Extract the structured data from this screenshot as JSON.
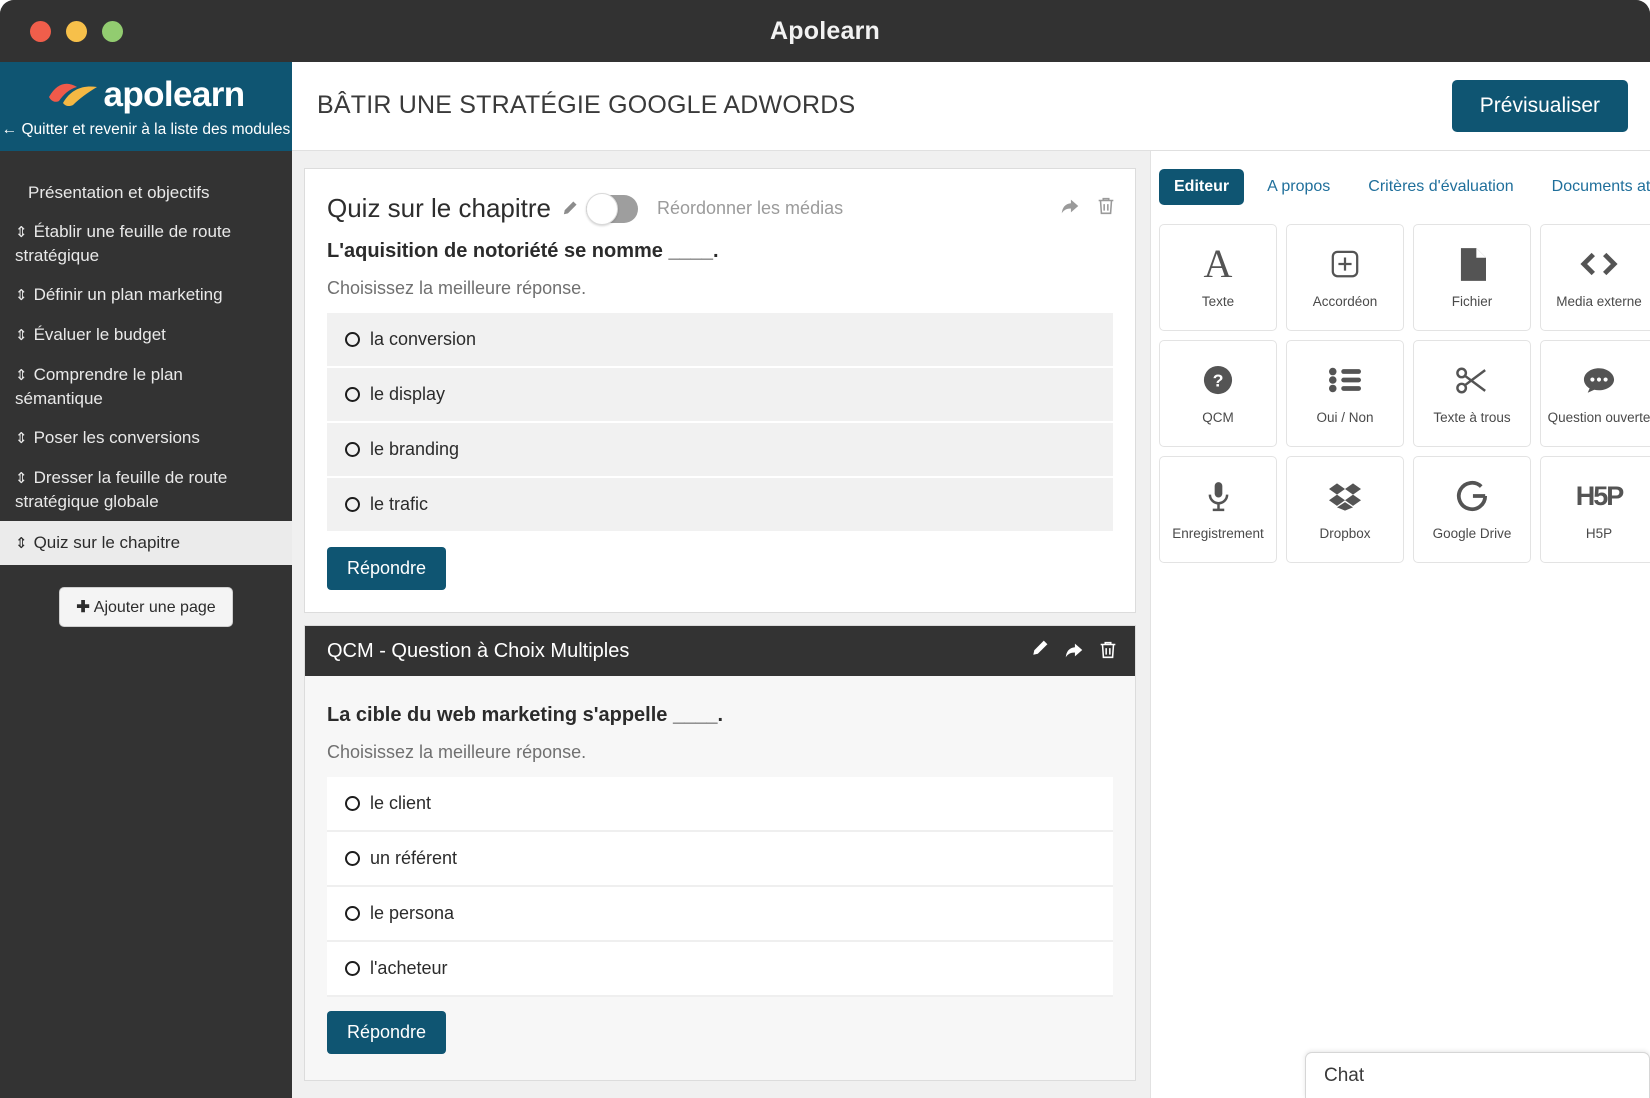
{
  "window": {
    "title": "Apolearn",
    "controls": [
      "close",
      "minimize",
      "maximize"
    ]
  },
  "sidebar": {
    "brand_name": "apolearn",
    "back_link": "← Quitter et revenir à la liste des modules",
    "items": [
      {
        "label": "Présentation et objectifs",
        "draggable": false,
        "active": false
      },
      {
        "label": "Établir une feuille de route stratégique",
        "draggable": true,
        "active": false
      },
      {
        "label": "Définir un plan marketing",
        "draggable": true,
        "active": false
      },
      {
        "label": "Évaluer le budget",
        "draggable": true,
        "active": false
      },
      {
        "label": "Comprendre le plan sémantique",
        "draggable": true,
        "active": false
      },
      {
        "label": "Poser les conversions",
        "draggable": true,
        "active": false
      },
      {
        "label": "Dresser la feuille de route stratégique globale",
        "draggable": true,
        "active": false
      },
      {
        "label": "Quiz sur le chapitre",
        "draggable": true,
        "active": true
      }
    ],
    "add_page_label": "Ajouter une page",
    "add_page_icon": "plus-icon"
  },
  "header": {
    "title": "BÂTIR UNE STRATÉGIE GOOGLE ADWORDS",
    "preview_label": "Prévisualiser"
  },
  "quiz": {
    "title": "Quiz sur le chapitre",
    "edit_icon": "pencil-icon",
    "reorder_toggle": {
      "label": "Réordonner les médias",
      "enabled": false
    },
    "actions": [
      "share-icon",
      "trash-icon"
    ],
    "question": {
      "text": "L'aquisition de notoriété se nomme ____.",
      "subtitle": "Choisissez la meilleure réponse.",
      "options": [
        "la conversion",
        "le display",
        "le branding",
        "le trafic"
      ],
      "answer_label": "Répondre"
    }
  },
  "qcm": {
    "bar_title": "QCM - Question à Choix Multiples",
    "bar_actions": [
      "pencil-icon",
      "share-icon",
      "trash-icon"
    ],
    "question": {
      "text": "La cible du web marketing s'appelle ____.",
      "subtitle": "Choisissez la meilleure réponse.",
      "options": [
        "le client",
        "un référent",
        "le persona",
        "l'acheteur"
      ],
      "answer_label": "Répondre"
    }
  },
  "right_panel": {
    "tabs": [
      {
        "label": "Editeur",
        "active": true
      },
      {
        "label": "A propos",
        "active": false
      },
      {
        "label": "Critères d'évaluation",
        "active": false
      },
      {
        "label": "Documents attachés",
        "active": false
      }
    ],
    "widgets": [
      {
        "label": "Texte",
        "icon": "letter-a-icon"
      },
      {
        "label": "Accordéon",
        "icon": "plus-square-icon"
      },
      {
        "label": "Fichier",
        "icon": "file-icon"
      },
      {
        "label": "Media externe",
        "icon": "code-brackets-icon"
      },
      {
        "label": "QCM",
        "icon": "question-circle-icon"
      },
      {
        "label": "Oui / Non",
        "icon": "list-icon"
      },
      {
        "label": "Texte à trous",
        "icon": "scissors-icon"
      },
      {
        "label": "Question ouverte",
        "icon": "speech-bubble-icon"
      },
      {
        "label": "Enregistrement",
        "icon": "microphone-icon"
      },
      {
        "label": "Dropbox",
        "icon": "dropbox-icon"
      },
      {
        "label": "Google Drive",
        "icon": "google-g-icon"
      },
      {
        "label": "H5P",
        "icon": "h5p-icon"
      }
    ]
  },
  "chat": {
    "label": "Chat"
  },
  "colors": {
    "brand_teal": "#0f5572",
    "sidebar_dark": "#333333",
    "titlebar": "#323232",
    "link_blue": "#1f6f9b"
  }
}
